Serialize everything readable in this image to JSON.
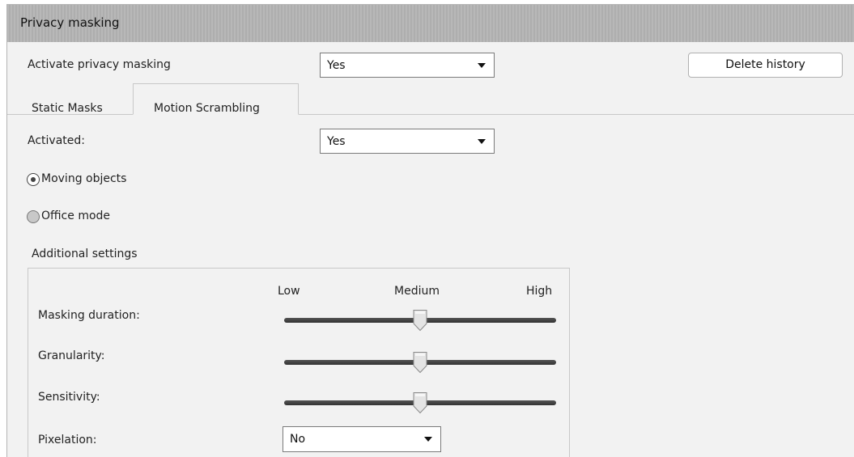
{
  "header": {
    "title": "Privacy masking"
  },
  "activate": {
    "label": "Activate privacy masking",
    "value": "Yes"
  },
  "delete_history_label": "Delete history",
  "tabs": [
    {
      "label": "Static Masks",
      "selected": false
    },
    {
      "label": "Motion Scrambling",
      "selected": true
    }
  ],
  "activated": {
    "label": "Activated:",
    "value": "Yes"
  },
  "modes": [
    {
      "label": "Moving objects",
      "selected": true
    },
    {
      "label": "Office mode",
      "selected": false
    }
  ],
  "additional": {
    "title": "Additional settings",
    "scale": {
      "low": "Low",
      "medium": "Medium",
      "high": "High"
    },
    "sliders": [
      {
        "label": "Masking duration:",
        "value": 0.5
      },
      {
        "label": "Granularity:",
        "value": 0.5
      },
      {
        "label": "Sensitivity:",
        "value": 0.5
      }
    ],
    "pixelation": {
      "label": "Pixelation:",
      "value": "No"
    }
  }
}
